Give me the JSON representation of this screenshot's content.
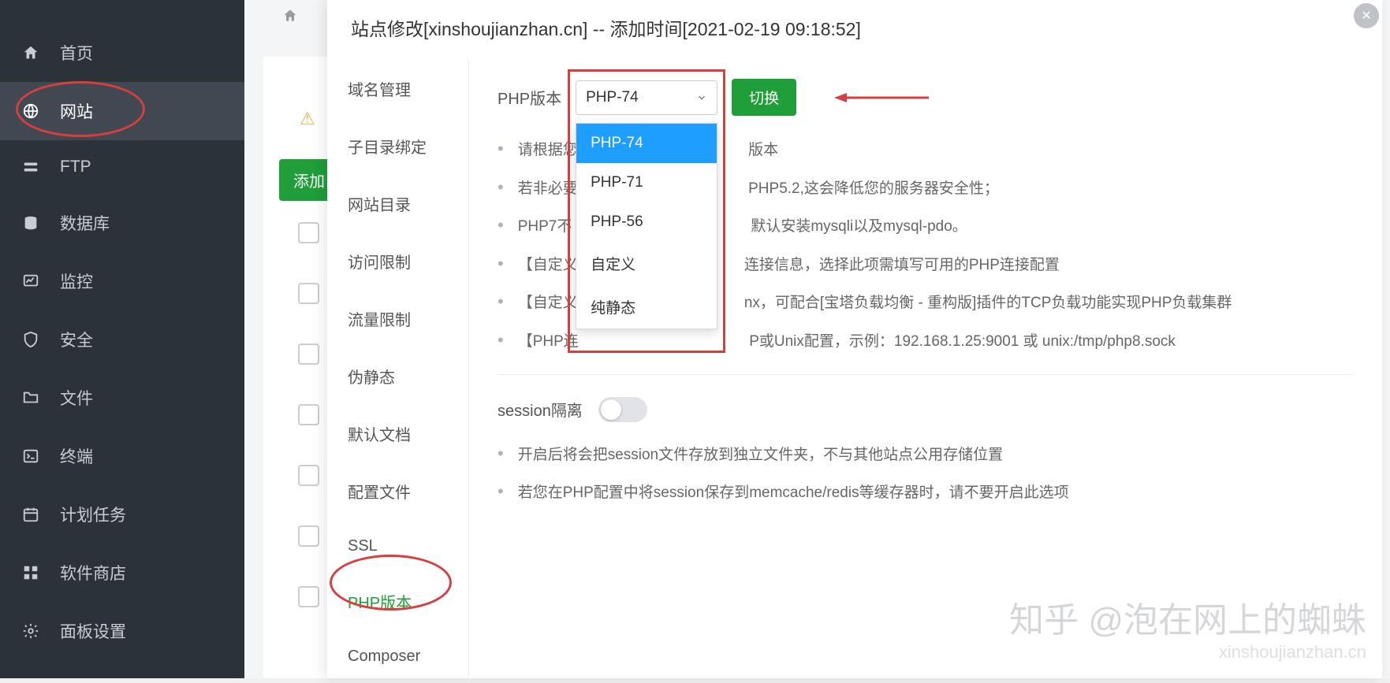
{
  "sidebar": {
    "items": [
      {
        "label": "首页"
      },
      {
        "label": "网站"
      },
      {
        "label": "FTP"
      },
      {
        "label": "数据库"
      },
      {
        "label": "监控"
      },
      {
        "label": "安全"
      },
      {
        "label": "文件"
      },
      {
        "label": "终端"
      },
      {
        "label": "计划任务"
      },
      {
        "label": "软件商店"
      },
      {
        "label": "面板设置"
      }
    ]
  },
  "content": {
    "add_button": "添加"
  },
  "modal": {
    "title": "站点修改[xinshoujianzhan.cn] -- 添加时间[2021-02-19 09:18:52]",
    "nav": [
      "域名管理",
      "子目录绑定",
      "网站目录",
      "访问限制",
      "流量限制",
      "伪静态",
      "默认文档",
      "配置文件",
      "SSL",
      "PHP版本",
      "Composer"
    ],
    "form": {
      "phpversion_label": "PHP版本",
      "selected": "PHP-74",
      "switch_label": "切换",
      "options": [
        "PHP-74",
        "PHP-71",
        "PHP-56",
        "自定义",
        "纯静态"
      ]
    },
    "tips": [
      "请根据您                                         版本",
      "若非必要                                         PHP5.2,这会降低您的服务器安全性；",
      "PHP7不                                           默认安装mysqli以及mysql-pdo。",
      "【自定义                                        连接信息，选择此项需填写可用的PHP连接配置",
      "【自定义                                        nx，可配合[宝塔负载均衡 - 重构版]插件的TCP负载功能实现PHP负载集群",
      "【PHP连                                         P或Unix配置，示例：192.168.1.25:9001 或 unix:/tmp/php8.sock"
    ],
    "session": {
      "label": "session隔离",
      "tips": [
        "开启后将会把session文件存放到独立文件夹，不与其他站点公用存储位置",
        "若您在PHP配置中将session保存到memcache/redis等缓存器时，请不要开启此选项"
      ]
    }
  },
  "watermark": {
    "main": "知乎 @泡在网上的蜘蛛",
    "sub": "xinshoujianzhan.cn"
  }
}
